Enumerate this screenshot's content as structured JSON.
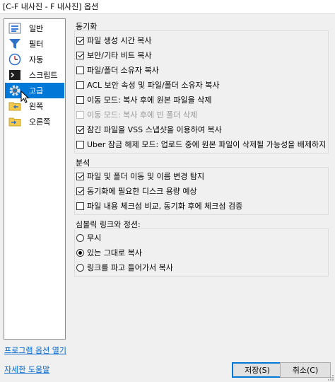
{
  "window": {
    "title": "[C-F 내사진 - F 내사진] 옵션"
  },
  "nav": {
    "items": [
      {
        "label": "일반",
        "icon": "settings-sliders-icon"
      },
      {
        "label": "필터",
        "icon": "funnel-icon"
      },
      {
        "label": "자동",
        "icon": "clock-icon"
      },
      {
        "label": "스크립트",
        "icon": "terminal-icon"
      },
      {
        "label": "고급",
        "icon": "gear-icon",
        "selected": true
      },
      {
        "label": "왼쪽",
        "icon": "folder-left-icon"
      },
      {
        "label": "오른쪽",
        "icon": "folder-right-icon"
      }
    ]
  },
  "sync": {
    "title": "동기화",
    "options": [
      {
        "label": "파일 생성 시간 복사",
        "checked": true
      },
      {
        "label": "보안/기타 비트 복사",
        "checked": true
      },
      {
        "label": "파일/폴더 소유자 복사",
        "checked": false
      },
      {
        "label": "ACL 보안 속성 및 파일/폴더 소유자 복사",
        "checked": false
      },
      {
        "label": "이동 모드: 복사 후에 원본 파일을 삭제",
        "checked": false
      },
      {
        "label": "이동 모드: 복사 후에 빈 폴더 삭제",
        "checked": false,
        "disabled": true
      },
      {
        "label": "잠긴 파일을 VSS 스냅샷을 이용하여 복사",
        "checked": true
      },
      {
        "label": "Uber 잠금 해제 모드: 업로드 중에 원본 파일이 삭제될 가능성을 배제하지 않",
        "checked": false
      }
    ]
  },
  "analysis": {
    "title": "분석",
    "options": [
      {
        "label": "파일 및 폴더 이동 및 이름 변경 탐지",
        "checked": true
      },
      {
        "label": "동기화에 필요한 디스크 용량 예상",
        "checked": true
      },
      {
        "label": "파일 내용 체크섬 비교, 동기화 후에 체크섬 검증",
        "checked": false
      }
    ]
  },
  "symlinks": {
    "title": "심볼릭 링크와 정션:",
    "options": [
      {
        "label": "무시",
        "selected": false
      },
      {
        "label": "있는 그대로 복사",
        "selected": true
      },
      {
        "label": "링크를 파고 들어가서 복사",
        "selected": false
      }
    ]
  },
  "footer": {
    "open_options_link": "프로그램 옵션 열기",
    "help_link": "자세한 도움말",
    "save_button": "저장(S)",
    "cancel_button": "취소(C)"
  },
  "colors": {
    "accent": "#0078d7",
    "link": "#0066cc"
  }
}
